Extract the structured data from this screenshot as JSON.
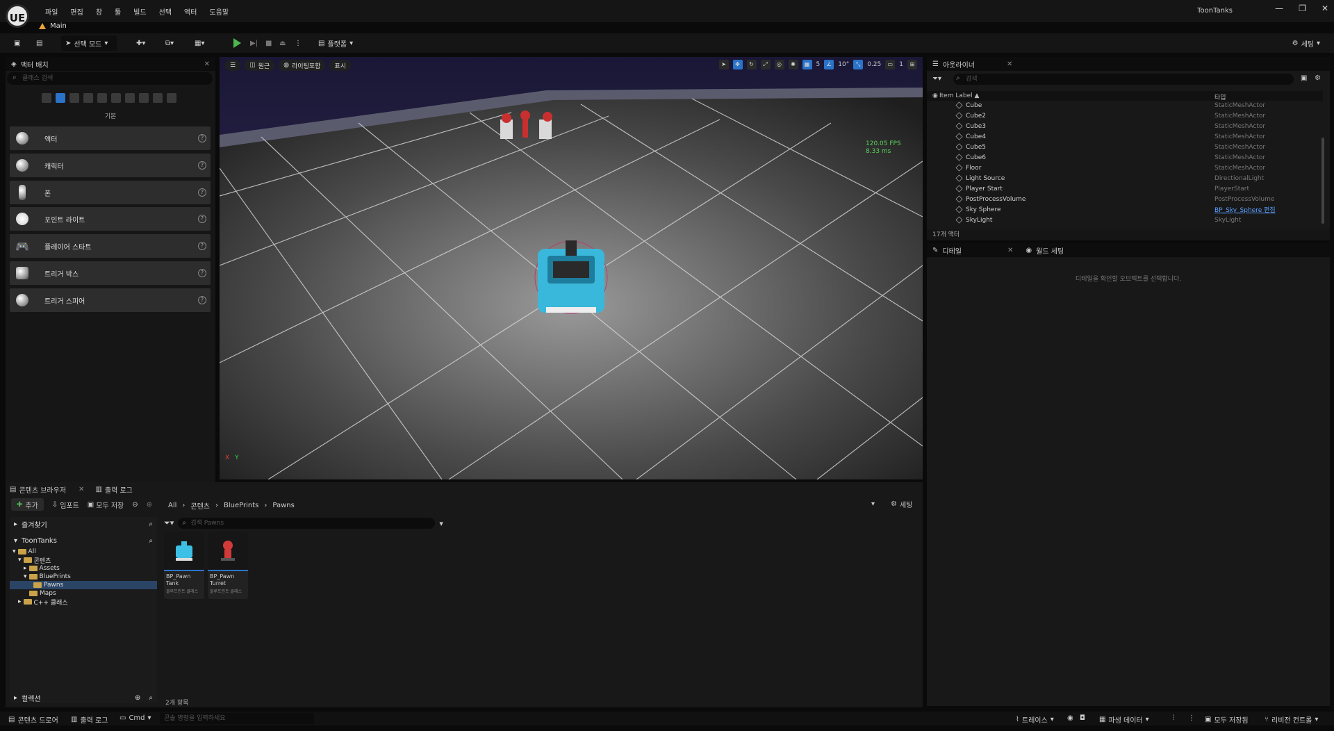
{
  "app": {
    "title": "ToonTanks",
    "logo": "UE",
    "main_tab": "Main",
    "menu": [
      "파일",
      "편집",
      "창",
      "툴",
      "빌드",
      "선택",
      "액터",
      "도움말"
    ],
    "window_controls": [
      "minimize-icon",
      "restore-icon",
      "close-icon"
    ]
  },
  "toolbar": {
    "mode_label": "선택 모드",
    "platforms_label": "플랫폼",
    "settings_label": "세팅"
  },
  "place_actors": {
    "tab_label": "액터 배치",
    "search_placeholder": "클래스 검색",
    "section_label": "기본",
    "items": [
      {
        "label": "액터"
      },
      {
        "label": "캐릭터"
      },
      {
        "label": "폰"
      },
      {
        "label": "포인트 라이트"
      },
      {
        "label": "플레이어 스타트"
      },
      {
        "label": "트리거 박스"
      },
      {
        "label": "트리거 스피어"
      }
    ]
  },
  "viewport": {
    "view_mode": "원근",
    "lighting": "라이팅포함",
    "show": "표시",
    "grid_snap": "5",
    "rotation_snap": "10°",
    "scale_snap": "0.25",
    "camera_speed": "1",
    "fps": "120.05 FPS",
    "frame_ms": "8.33 ms",
    "axis_x": "X",
    "axis_y": "Y"
  },
  "outliner": {
    "tab_label": "아웃라이너",
    "search_placeholder": "검색",
    "col_label": "Item Label ▲",
    "col_type": "타입",
    "rows": [
      {
        "label": "Cube",
        "type": "StaticMeshActor"
      },
      {
        "label": "Cube2",
        "type": "StaticMeshActor"
      },
      {
        "label": "Cube3",
        "type": "StaticMeshActor"
      },
      {
        "label": "Cube4",
        "type": "StaticMeshActor"
      },
      {
        "label": "Cube5",
        "type": "StaticMeshActor"
      },
      {
        "label": "Cube6",
        "type": "StaticMeshActor"
      },
      {
        "label": "Floor",
        "type": "StaticMeshActor"
      },
      {
        "label": "Light Source",
        "type": "DirectionalLight"
      },
      {
        "label": "Player Start",
        "type": "PlayerStart"
      },
      {
        "label": "PostProcessVolume",
        "type": "PostProcessVolume"
      },
      {
        "label": "Sky Sphere",
        "type": "BP_Sky_Sphere 편집"
      },
      {
        "label": "SkyLight",
        "type": "SkyLight"
      }
    ],
    "actor_count": "17개 액터"
  },
  "details": {
    "tab_label": "디테일",
    "world_settings_tab": "월드 세팅",
    "hint": "디테일을 확인할 오브젝트를 선택합니다."
  },
  "content_browser": {
    "tab_label": "콘텐츠 브라우저",
    "output_log_tab": "출력 로그",
    "add_label": "추가",
    "import_label": "임포트",
    "save_all_label": "모두 저장",
    "breadcrumb": [
      "All",
      "콘텐츠",
      "BluePrints",
      "Pawns"
    ],
    "settings_label": "세팅",
    "favorites_label": "즐겨찾기",
    "project_label": "ToonTanks",
    "tree": [
      {
        "label": "All",
        "depth": 0
      },
      {
        "label": "콘텐츠",
        "depth": 1
      },
      {
        "label": "Assets",
        "depth": 2
      },
      {
        "label": "BluePrints",
        "depth": 2
      },
      {
        "label": "Pawns",
        "depth": 3
      },
      {
        "label": "Maps",
        "depth": 2
      },
      {
        "label": "C++ 클래스",
        "depth": 1
      }
    ],
    "search_placeholder": "검색 Pawns",
    "assets": [
      {
        "name": "BP_Pawn Tank",
        "kind": "블루프린트 클래스",
        "color": "#3cc0e6"
      },
      {
        "name": "BP_Pawn Turret",
        "kind": "블루프린트 클래스",
        "color": "#d23a3a"
      }
    ],
    "item_count": "2개 항목",
    "collections_label": "컬렉션"
  },
  "statusbar": {
    "content_drawer": "콘텐츠 드로어",
    "output_log": "출력 로그",
    "cmd": "Cmd",
    "cmd_placeholder": "콘솔 명령을 입력하세요",
    "trace": "트레이스",
    "derived_data": "파생 데이터",
    "save_all": "모두 저장됨",
    "revision_control": "리비전 컨트롤"
  }
}
